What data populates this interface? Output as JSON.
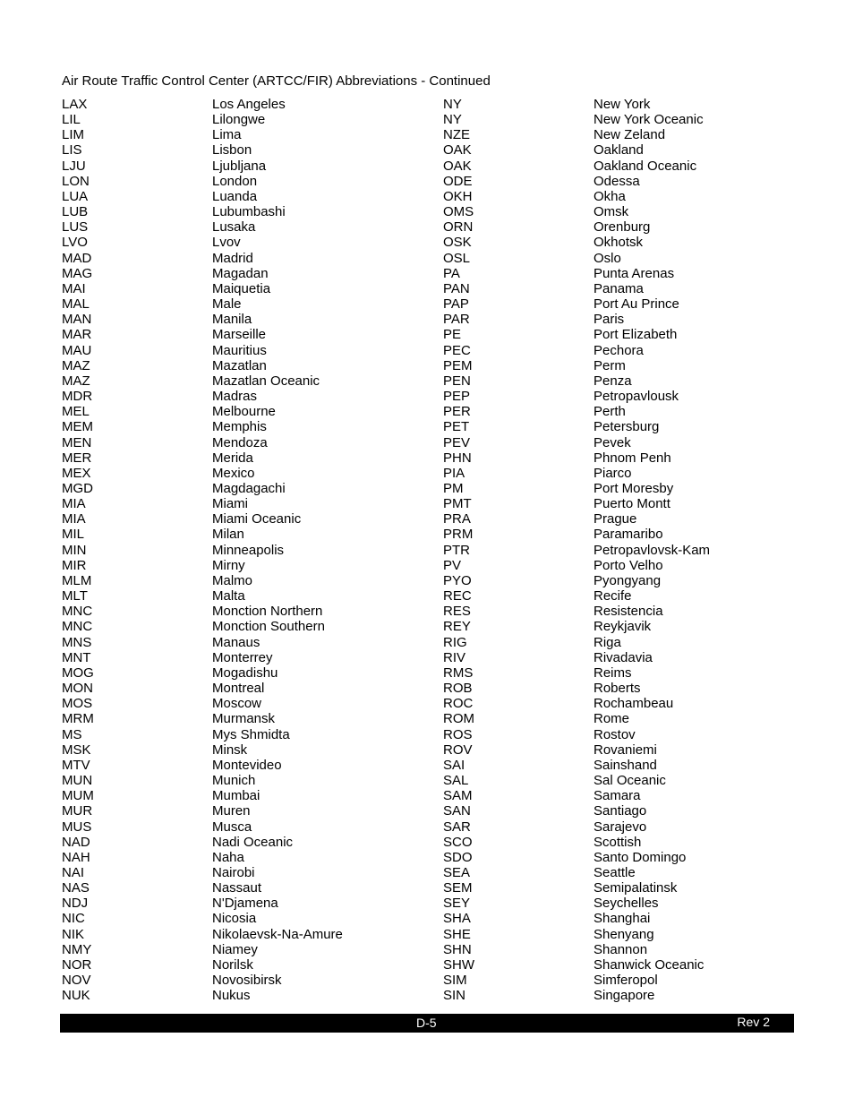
{
  "title": "Air Route Traffic Control Center (ARTCC/FIR) Abbreviations - Continued",
  "left": [
    [
      "LAX",
      "Los Angeles"
    ],
    [
      "LIL",
      "Lilongwe"
    ],
    [
      "LIM",
      "Lima"
    ],
    [
      "LIS",
      "Lisbon"
    ],
    [
      "LJU",
      "Ljubljana"
    ],
    [
      "LON",
      "London"
    ],
    [
      "LUA",
      "Luanda"
    ],
    [
      "LUB",
      "Lubumbashi"
    ],
    [
      "LUS",
      "Lusaka"
    ],
    [
      "LVO",
      "Lvov"
    ],
    [
      "MAD",
      "Madrid"
    ],
    [
      "MAG",
      "Magadan"
    ],
    [
      "MAI",
      "Maiquetia"
    ],
    [
      "MAL",
      "Male"
    ],
    [
      "MAN",
      "Manila"
    ],
    [
      "MAR",
      "Marseille"
    ],
    [
      "MAU",
      "Mauritius"
    ],
    [
      "MAZ",
      "Mazatlan"
    ],
    [
      "MAZ",
      "Mazatlan Oceanic"
    ],
    [
      "MDR",
      "Madras"
    ],
    [
      "MEL",
      "Melbourne"
    ],
    [
      "MEM",
      "Memphis"
    ],
    [
      "MEN",
      "Mendoza"
    ],
    [
      "MER",
      "Merida"
    ],
    [
      "MEX",
      "Mexico"
    ],
    [
      "MGD",
      "Magdagachi"
    ],
    [
      "MIA",
      "Miami"
    ],
    [
      "MIA",
      "Miami Oceanic"
    ],
    [
      "MIL",
      "Milan"
    ],
    [
      "MIN",
      "Minneapolis"
    ],
    [
      "MIR",
      "Mirny"
    ],
    [
      "MLM",
      "Malmo"
    ],
    [
      "MLT",
      "Malta"
    ],
    [
      "MNC",
      "Monction Northern"
    ],
    [
      "MNC",
      "Monction Southern"
    ],
    [
      "MNS",
      "Manaus"
    ],
    [
      "MNT",
      "Monterrey"
    ],
    [
      "MOG",
      "Mogadishu"
    ],
    [
      "MON",
      "Montreal"
    ],
    [
      "MOS",
      "Moscow"
    ],
    [
      "MRM",
      "Murmansk"
    ],
    [
      "MS",
      "Mys Shmidta"
    ],
    [
      "MSK",
      "Minsk"
    ],
    [
      "MTV",
      "Montevideo"
    ],
    [
      "MUN",
      "Munich"
    ],
    [
      "MUM",
      "Mumbai"
    ],
    [
      "MUR",
      "Muren"
    ],
    [
      "MUS",
      "Musca"
    ],
    [
      "NAD",
      "Nadi Oceanic"
    ],
    [
      "NAH",
      "Naha"
    ],
    [
      "NAI",
      "Nairobi"
    ],
    [
      "NAS",
      "Nassaut"
    ],
    [
      "NDJ",
      "N'Djamena"
    ],
    [
      "NIC",
      "Nicosia"
    ],
    [
      "NIK",
      "Nikolaevsk-Na-Amure"
    ],
    [
      "NMY",
      "Niamey"
    ],
    [
      "NOR",
      "Norilsk"
    ],
    [
      "NOV",
      "Novosibirsk"
    ],
    [
      "NUK",
      "Nukus"
    ]
  ],
  "right": [
    [
      "NY",
      "New York"
    ],
    [
      "NY",
      "New York Oceanic"
    ],
    [
      "NZE",
      "New Zeland"
    ],
    [
      "OAK",
      "Oakland"
    ],
    [
      "OAK",
      "Oakland Oceanic"
    ],
    [
      "ODE",
      "Odessa"
    ],
    [
      "OKH",
      "Okha"
    ],
    [
      "OMS",
      "Omsk"
    ],
    [
      "ORN",
      "Orenburg"
    ],
    [
      "OSK",
      "Okhotsk"
    ],
    [
      "OSL",
      "Oslo"
    ],
    [
      "PA",
      "Punta Arenas"
    ],
    [
      "PAN",
      "Panama"
    ],
    [
      "PAP",
      "Port Au Prince"
    ],
    [
      "PAR",
      "Paris"
    ],
    [
      "PE",
      "Port Elizabeth"
    ],
    [
      "PEC",
      "Pechora"
    ],
    [
      "PEM",
      "Perm"
    ],
    [
      "PEN",
      "Penza"
    ],
    [
      "PEP",
      "Petropavlousk"
    ],
    [
      "PER",
      "Perth"
    ],
    [
      "PET",
      "Petersburg"
    ],
    [
      "PEV",
      "Pevek"
    ],
    [
      "PHN",
      "Phnom Penh"
    ],
    [
      "PIA",
      "Piarco"
    ],
    [
      "PM",
      "Port Moresby"
    ],
    [
      "PMT",
      "Puerto Montt"
    ],
    [
      "PRA",
      "Prague"
    ],
    [
      "PRM",
      "Paramaribo"
    ],
    [
      "PTR",
      "Petropavlovsk-Kam"
    ],
    [
      "PV",
      "Porto Velho"
    ],
    [
      "PYO",
      "Pyongyang"
    ],
    [
      "REC",
      "Recife"
    ],
    [
      "RES",
      "Resistencia"
    ],
    [
      "REY",
      "Reykjavik"
    ],
    [
      "RIG",
      "Riga"
    ],
    [
      "RIV",
      "Rivadavia"
    ],
    [
      "RMS",
      "Reims"
    ],
    [
      "ROB",
      "Roberts"
    ],
    [
      "ROC",
      "Rochambeau"
    ],
    [
      "ROM",
      "Rome"
    ],
    [
      "ROS",
      "Rostov"
    ],
    [
      "ROV",
      "Rovaniemi"
    ],
    [
      "SAI",
      "Sainshand"
    ],
    [
      "SAL",
      "Sal Oceanic"
    ],
    [
      "SAM",
      "Samara"
    ],
    [
      "SAN",
      "Santiago"
    ],
    [
      "SAR",
      "Sarajevo"
    ],
    [
      "SCO",
      "Scottish"
    ],
    [
      "SDO",
      "Santo Domingo"
    ],
    [
      "SEA",
      "Seattle"
    ],
    [
      "SEM",
      "Semipalatinsk"
    ],
    [
      "SEY",
      "Seychelles"
    ],
    [
      "SHA",
      "Shanghai"
    ],
    [
      "SHE",
      "Shenyang"
    ],
    [
      "SHN",
      "Shannon"
    ],
    [
      "SHW",
      "Shanwick Oceanic"
    ],
    [
      "SIM",
      "Simferopol"
    ],
    [
      "SIN",
      "Singapore"
    ]
  ],
  "footer": {
    "page": "D-5",
    "revision": "Rev 2"
  }
}
